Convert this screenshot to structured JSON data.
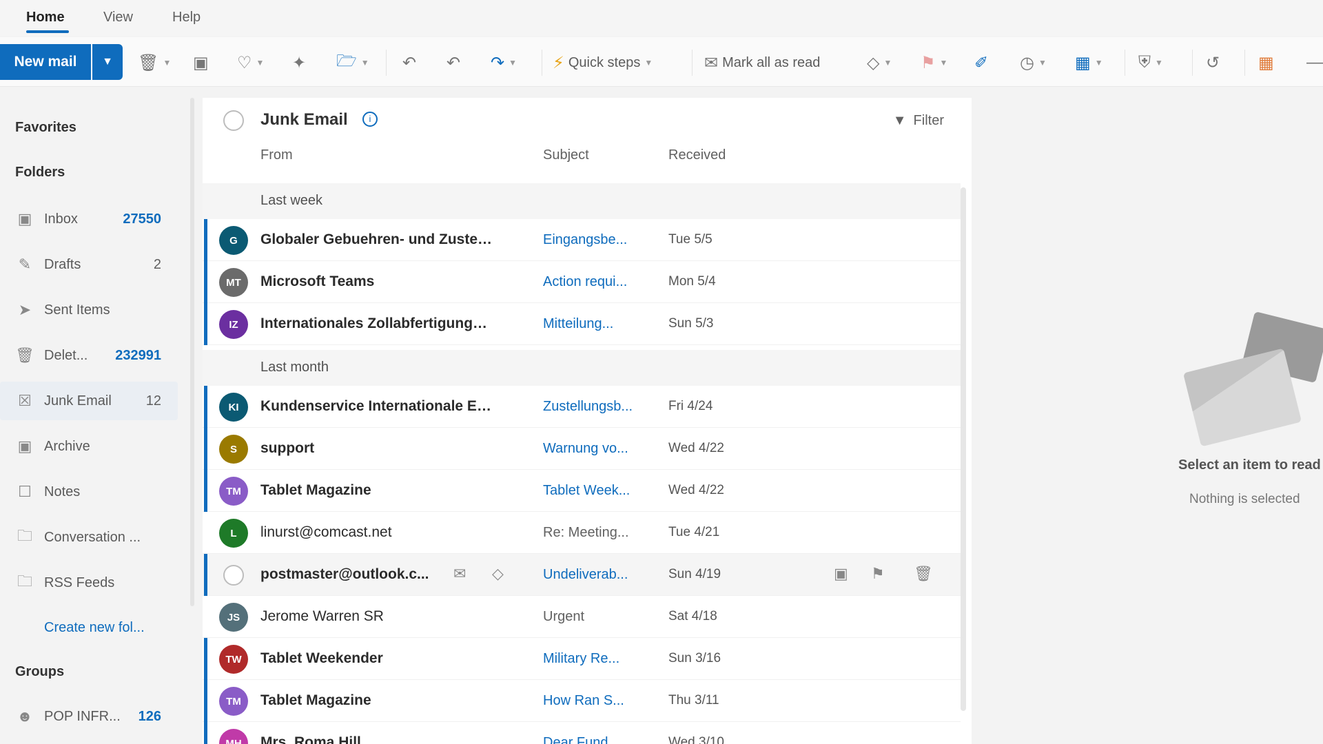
{
  "menu": {
    "tabs": [
      "Home",
      "View",
      "Help"
    ]
  },
  "ribbon": {
    "new_mail": "New mail",
    "quick_steps": "Quick steps",
    "mark_all_read": "Mark all as read"
  },
  "nav": {
    "favorites": "Favorites",
    "folders": "Folders",
    "items": [
      {
        "label": "Inbox",
        "count": "27550"
      },
      {
        "label": "Drafts",
        "count": "2"
      },
      {
        "label": "Sent Items",
        "count": ""
      },
      {
        "label": "Delet...",
        "count": "232991"
      },
      {
        "label": "Junk Email",
        "count": "12"
      },
      {
        "label": "Archive",
        "count": ""
      },
      {
        "label": "Notes",
        "count": ""
      },
      {
        "label": "Conversation ...",
        "count": ""
      },
      {
        "label": "RSS Feeds",
        "count": ""
      }
    ],
    "create_folder": "Create new fol...",
    "groups": "Groups",
    "group_items": [
      {
        "label": "POP INFR...",
        "count": "126"
      }
    ]
  },
  "list": {
    "folder_title": "Junk Email",
    "filter": "Filter",
    "columns": {
      "from": "From",
      "subject": "Subject",
      "received": "Received"
    },
    "groups": [
      "Last week",
      "Last month"
    ],
    "messages": [
      {
        "initials": "G",
        "color": "#0b5a73",
        "sender": "Globaler Gebuehren- und Zusteller-Service",
        "subject": "Eingangsbe...",
        "date": "Tue 5/5"
      },
      {
        "initials": "MT",
        "color": "#6b6b6b",
        "sender": "Microsoft Teams",
        "subject": "Action requi...",
        "date": "Mon 5/4"
      },
      {
        "initials": "IZ",
        "color": "#6b2fa0",
        "sender": "Internationales Zollabfertigungsamt",
        "subject": "Mitteilung...",
        "date": "Sun 5/3"
      },
      {
        "initials": "KI",
        "color": "#0b5a73",
        "sender": "Kundenservice Internationale Express",
        "subject": "Zustellungsb...",
        "date": "Fri 4/24"
      },
      {
        "initials": "S",
        "color": "#9a7a00",
        "sender": "support",
        "subject": "Warnung vo...",
        "date": "Wed 4/22"
      },
      {
        "initials": "TM",
        "color": "#8a5cc7",
        "sender": "Tablet Magazine",
        "subject": "Tablet Week...",
        "date": "Wed 4/22"
      },
      {
        "initials": "L",
        "color": "#1e7a28",
        "sender": "linurst@comcast.net",
        "subject": "Re: Meeting...",
        "date": "Tue 4/21"
      },
      {
        "initials": "",
        "color": "",
        "sender": "postmaster@outlook.c...",
        "subject": "Undeliverab...",
        "date": "Sun 4/19"
      },
      {
        "initials": "JS",
        "color": "#54707a",
        "sender": "Jerome Warren SR",
        "subject": "Urgent",
        "date": "Sat 4/18"
      },
      {
        "initials": "TW",
        "color": "#b02a2a",
        "sender": "Tablet Weekender",
        "subject": "Military Re...",
        "date": "Sun 3/16"
      },
      {
        "initials": "TM",
        "color": "#8a5cc7",
        "sender": "Tablet Magazine",
        "subject": "How Ran S...",
        "date": "Thu 3/11"
      },
      {
        "initials": "MH",
        "color": "#c03aa8",
        "sender": "Mrs. Roma Hill",
        "subject": "Dear Fund...",
        "date": "Wed 3/10"
      }
    ]
  },
  "reading": {
    "title": "Select an item to read",
    "subtitle": "Nothing is selected"
  }
}
